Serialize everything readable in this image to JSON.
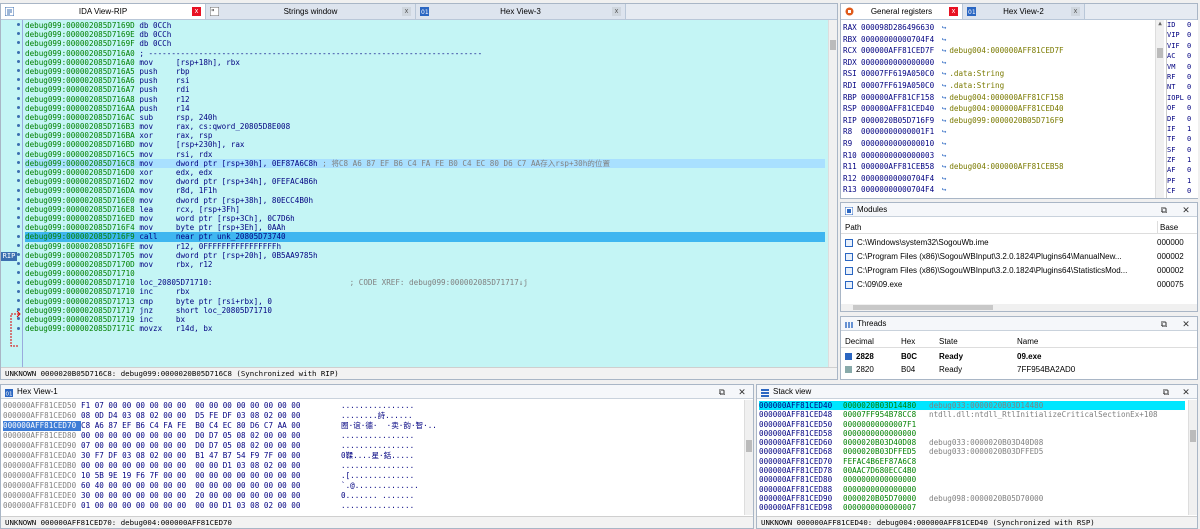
{
  "tabs_top_left": [
    {
      "label": "IDA View-RIP",
      "active": true
    },
    {
      "label": "Strings window",
      "active": false
    },
    {
      "label": "Hex View-3",
      "active": false
    }
  ],
  "tabs_top_right": [
    {
      "label": "General registers",
      "active": true
    },
    {
      "label": "Hex View-2",
      "active": false
    }
  ],
  "ida_lines": [
    {
      "addr": "debug099:000002085D7169D",
      "code": "db 0CCh",
      "comment": ""
    },
    {
      "addr": "debug099:000002085D7169E",
      "code": "db 0CCh",
      "comment": ""
    },
    {
      "addr": "debug099:000002085D7169F",
      "code": "db 0CCh",
      "comment": ""
    },
    {
      "addr": "debug099:000002085D716A0",
      "code": "; -------------------------------------------------------------------------",
      "comment": ""
    },
    {
      "addr": "debug099:000002085D716A0",
      "code": "mov     [rsp+18h], rbx",
      "comment": ""
    },
    {
      "addr": "debug099:000002085D716A5",
      "code": "push    rbp",
      "comment": ""
    },
    {
      "addr": "debug099:000002085D716A6",
      "code": "push    rsi",
      "comment": ""
    },
    {
      "addr": "debug099:000002085D716A7",
      "code": "push    rdi",
      "comment": ""
    },
    {
      "addr": "debug099:000002085D716A8",
      "code": "push    r12",
      "comment": ""
    },
    {
      "addr": "debug099:000002085D716AA",
      "code": "push    r14",
      "comment": ""
    },
    {
      "addr": "debug099:000002085D716AC",
      "code": "sub     rsp, 240h",
      "comment": ""
    },
    {
      "addr": "debug099:000002085D716B3",
      "code": "mov     rax, cs:qword_20805D8E008",
      "comment": ""
    },
    {
      "addr": "debug099:000002085D716BA",
      "code": "xor     rax, rsp",
      "comment": ""
    },
    {
      "addr": "debug099:000002085D716BD",
      "code": "mov     [rsp+230h], rax",
      "comment": ""
    },
    {
      "addr": "debug099:000002085D716C5",
      "code": "mov     rsi, rdx",
      "comment": ""
    },
    {
      "addr": "debug099:000002085D716C8",
      "code": "mov     dword ptr [rsp+30h], 0EF87A6C8h",
      "comment": " ; 将C8 A6 87 EF B6 C4 FA FE B0 C4 EC 80 D6 C7 AA存入rsp+30h的位置",
      "selected": true
    },
    {
      "addr": "debug099:000002085D716D0",
      "code": "xor     edx, edx",
      "comment": ""
    },
    {
      "addr": "debug099:000002085D716D2",
      "code": "mov     dword ptr [rsp+34h], 0FEFAC4B6h",
      "comment": ""
    },
    {
      "addr": "debug099:000002085D716DA",
      "code": "mov     r8d, 1F1h",
      "comment": ""
    },
    {
      "addr": "debug099:000002085D716E0",
      "code": "mov     dword ptr [rsp+38h], 80ECC4B0h",
      "comment": ""
    },
    {
      "addr": "debug099:000002085D716E8",
      "code": "lea     rcx, [rsp+3Fh]",
      "comment": ""
    },
    {
      "addr": "debug099:000002085D716ED",
      "code": "mov     word ptr [rsp+3Ch], 0C7D6h",
      "comment": ""
    },
    {
      "addr": "debug099:000002085D716F4",
      "code": "mov     byte ptr [rsp+3Eh], 0AAh",
      "comment": ""
    },
    {
      "addr": "debug099:000002085D716F9",
      "code": "call    near ptr unk_20805D73740",
      "comment": "",
      "rip": true
    },
    {
      "addr": "debug099:000002085D716FE",
      "code": "mov     r12, 0FFFFFFFFFFFFFFFFh",
      "comment": ""
    },
    {
      "addr": "debug099:000002085D71705",
      "code": "mov     dword ptr [rsp+20h], 0B5AA9785h",
      "comment": ""
    },
    {
      "addr": "debug099:000002085D7170D",
      "code": "mov     rbx, r12",
      "comment": ""
    },
    {
      "addr": "debug099:000002085D71710",
      "code": "",
      "comment": ""
    },
    {
      "addr": "debug099:000002085D71710",
      "code": "loc_20805D71710:",
      "comment": "                              ; CODE XREF: debug099:000002085D71717↓j"
    },
    {
      "addr": "debug099:000002085D71710",
      "code": "inc     rbx",
      "comment": ""
    },
    {
      "addr": "debug099:000002085D71713",
      "code": "cmp     byte ptr [rsi+rbx], 0",
      "comment": ""
    },
    {
      "addr": "debug099:000002085D71717",
      "code": "jnz     short loc_20805D71710",
      "comment": ""
    },
    {
      "addr": "debug099:000002085D71719",
      "code": "inc     bx",
      "comment": ""
    },
    {
      "addr": "debug099:000002085D7171C",
      "code": "movzx   r14d, bx",
      "comment": ""
    }
  ],
  "ida_status": "UNKNOWN 0000020B05D716C8: debug099:0000020B05D716C8 (Synchronized with RIP)",
  "rip_marker": "RIP",
  "registers": [
    {
      "name": "RAX",
      "value": "000098D286496630",
      "ref": ""
    },
    {
      "name": "RBX",
      "value": "00000000000704F4",
      "ref": ""
    },
    {
      "name": "RCX",
      "value": "000000AFF81CED7F",
      "ref": "debug004:000000AFF81CED7F"
    },
    {
      "name": "RDX",
      "value": "0000000000000000",
      "ref": ""
    },
    {
      "name": "RSI",
      "value": "00007FF619A050C0",
      "ref": ".data:String"
    },
    {
      "name": "RDI",
      "value": "00007FF619A050C0",
      "ref": ".data:String"
    },
    {
      "name": "RBP",
      "value": "000000AFF81CF158",
      "ref": "debug004:000000AFF81CF158"
    },
    {
      "name": "RSP",
      "value": "000000AFF81CED40",
      "ref": "debug004:000000AFF81CED40"
    },
    {
      "name": "RIP",
      "value": "0000020B05D716F9",
      "ref": "debug099:0000020B05D716F9"
    },
    {
      "name": "R8",
      "value": "00000000000001F1",
      "ref": ""
    },
    {
      "name": "R9",
      "value": "0000000000000010",
      "ref": ""
    },
    {
      "name": "R10",
      "value": "0000000000000003",
      "ref": ""
    },
    {
      "name": "R11",
      "value": "000000AFF81CEB58",
      "ref": "debug004:000000AFF81CEB58"
    },
    {
      "name": "R12",
      "value": "00000000000704F4",
      "ref": ""
    },
    {
      "name": "R13",
      "value": "00000000000704F4",
      "ref": ""
    }
  ],
  "flags": [
    {
      "name": "ID",
      "value": "0"
    },
    {
      "name": "VIP",
      "value": "0"
    },
    {
      "name": "VIF",
      "value": "0"
    },
    {
      "name": "AC",
      "value": "0"
    },
    {
      "name": "VM",
      "value": "0"
    },
    {
      "name": "RF",
      "value": "0"
    },
    {
      "name": "NT",
      "value": "0"
    },
    {
      "name": "IOPL",
      "value": "0"
    },
    {
      "name": "OF",
      "value": "0"
    },
    {
      "name": "DF",
      "value": "0"
    },
    {
      "name": "IF",
      "value": "1"
    },
    {
      "name": "TF",
      "value": "0"
    },
    {
      "name": "SF",
      "value": "0"
    },
    {
      "name": "ZF",
      "value": "1"
    },
    {
      "name": "AF",
      "value": "0"
    },
    {
      "name": "PF",
      "value": "1"
    },
    {
      "name": "CF",
      "value": "0"
    }
  ],
  "modules": {
    "title": "Modules",
    "col_path": "Path",
    "col_base": "Base",
    "rows": [
      {
        "path": "C:\\Windows\\system32\\SogouWb.ime",
        "base": "000000"
      },
      {
        "path": "C:\\Program Files (x86)\\SogouWBInput\\3.2.0.1824\\Plugins64\\ManualNew...",
        "base": "000002"
      },
      {
        "path": "C:\\Program Files (x86)\\SogouWBInput\\3.2.0.1824\\Plugins64\\StatisticsMod...",
        "base": "000002"
      },
      {
        "path": "C:\\09\\09.exe",
        "base": "000075"
      }
    ]
  },
  "threads": {
    "title": "Threads",
    "cols": [
      "Decimal",
      "Hex",
      "State",
      "Name"
    ],
    "rows": [
      {
        "dec": "2828",
        "hex": "B0C",
        "state": "Ready",
        "name": "09.exe",
        "bold": true
      },
      {
        "dec": "2820",
        "hex": "B04",
        "state": "Ready",
        "name": "7FF954BA2AD0",
        "bold": false
      }
    ]
  },
  "hex1": {
    "title": "Hex View-1",
    "rows": [
      {
        "addr": "000000AFF81CED50",
        "bytes": "F1 07 00 00 00 00 00 00  00 00 00 00 00 00 00 00",
        "ascii": "................"
      },
      {
        "addr": "000000AFF81CED60",
        "bytes": "08 0D D4 03 08 02 00 00  D5 FE DF 03 08 02 00 00",
        "ascii": "........詩......"
      },
      {
        "addr": "000000AFF81CED70",
        "bytes": "C8 A6 87 EF B6 C4 FA FE  B0 C4 EC 80 D6 C7 AA 00",
        "ascii": "圈·谊·德·  ·卖·韵·智·..",
        "selected": true
      },
      {
        "addr": "000000AFF81CED80",
        "bytes": "00 00 00 00 00 00 00 00  D0 D7 05 08 02 00 00 00",
        "ascii": "................"
      },
      {
        "addr": "000000AFF81CED90",
        "bytes": "07 00 00 00 00 00 00 00  D0 D7 05 08 02 00 00 00",
        "ascii": "................"
      },
      {
        "addr": "000000AFF81CEDA0",
        "bytes": "30 F7 DF 03 08 02 00 00  B1 47 B7 54 F9 7F 00 00",
        "ascii": "0鞣....星·銛....."
      },
      {
        "addr": "000000AFF81CEDB0",
        "bytes": "00 00 00 00 00 00 00 00  00 00 D1 03 08 02 00 00",
        "ascii": "................"
      },
      {
        "addr": "000000AFF81CEDC0",
        "bytes": "10 5B 9E 19 F6 7F 00 00  00 00 00 00 00 00 00 00",
        "ascii": ".[.............."
      },
      {
        "addr": "000000AFF81CEDD0",
        "bytes": "60 40 00 00 00 00 00 00  00 00 00 00 00 00 00 00",
        "ascii": "`.@.............."
      },
      {
        "addr": "000000AFF81CEDE0",
        "bytes": "30 00 00 00 00 00 00 00  20 00 00 00 00 00 00 00",
        "ascii": "0....... ......."
      },
      {
        "addr": "000000AFF81CEDF0",
        "bytes": "01 00 00 00 00 00 00 00  00 00 D1 03 08 02 00 00",
        "ascii": "................"
      }
    ],
    "status": "UNKNOWN 000000AFF81CED70: debug004:000000AFF81CED70"
  },
  "stack": {
    "title": "Stack view",
    "rows": [
      {
        "addr": "000000AFF81CED40",
        "val": "0000020B03D14480",
        "ref": "debug033:0000020B03D14480",
        "selected": true
      },
      {
        "addr": "000000AFF81CED48",
        "val": "00007FF954B78CC8",
        "ref": "ntdll.dll:ntdll_RtlInitializeCriticalSectionEx+108"
      },
      {
        "addr": "000000AFF81CED50",
        "val": "00000000000007F1",
        "ref": ""
      },
      {
        "addr": "000000AFF81CED58",
        "val": "0000000000000000",
        "ref": ""
      },
      {
        "addr": "000000AFF81CED60",
        "val": "0000020B03D40D08",
        "ref": "debug033:0000020B03D40D08"
      },
      {
        "addr": "000000AFF81CED68",
        "val": "0000020B03DFFED5",
        "ref": "debug033:0000020B03DFFED5"
      },
      {
        "addr": "000000AFF81CED70",
        "val": "FEFAC4B6EF87A6C8",
        "ref": ""
      },
      {
        "addr": "000000AFF81CED78",
        "val": "00AAC7D680ECC4B0",
        "ref": ""
      },
      {
        "addr": "000000AFF81CED80",
        "val": "0000000000000000",
        "ref": ""
      },
      {
        "addr": "000000AFF81CED88",
        "val": "0000000000000000",
        "ref": ""
      },
      {
        "addr": "000000AFF81CED90",
        "val": "0000020B05D70000",
        "ref": "debug098:0000020B05D70000"
      },
      {
        "addr": "000000AFF81CED98",
        "val": "0000000000000007",
        "ref": ""
      }
    ],
    "status": "UNKNOWN 000000AFF81CED40: debug004:000000AFF81CED40 (Synchronized with RSP)"
  },
  "colors": {
    "ida_bg": "#c4f5f5",
    "rip_line": "#3fb6f0",
    "selected_line": "#a9e0ff",
    "hex_selected": "#3d7cd6",
    "stack_selected": "#00e6ff"
  }
}
